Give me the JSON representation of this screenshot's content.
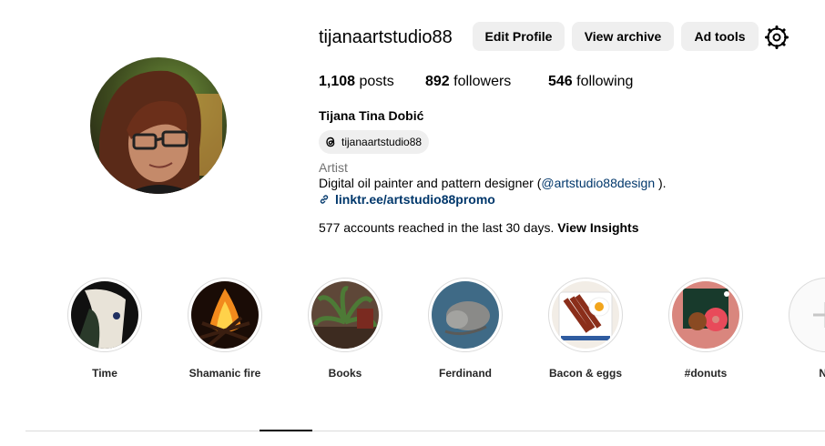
{
  "profile": {
    "username": "tijanaartstudio88",
    "edit_label": "Edit Profile",
    "archive_label": "View archive",
    "adtools_label": "Ad tools",
    "settings_icon": "settings-gear-icon",
    "posts_count": "1,108",
    "posts_label": "posts",
    "followers_count": "892",
    "followers_label": "followers",
    "following_count": "546",
    "following_label": "following",
    "full_name": "Tijana Tina Dobić",
    "threads_handle": "tijanaartstudio88",
    "category": "Artist",
    "bio_prefix": "Digital oil painter and pattern designer (",
    "bio_mention": "@artstudio88design",
    "bio_suffix": " ).",
    "link": "linktr.ee/artstudio88promo",
    "reach_text": "577 accounts reached in the last 30 days.",
    "insights_label": "View Insights"
  },
  "highlights": [
    {
      "label": "Time"
    },
    {
      "label": "Shamanic fire"
    },
    {
      "label": "Books"
    },
    {
      "label": "Ferdinand"
    },
    {
      "label": "Bacon & eggs"
    },
    {
      "label": "#donuts"
    },
    {
      "label": "Ne"
    }
  ]
}
